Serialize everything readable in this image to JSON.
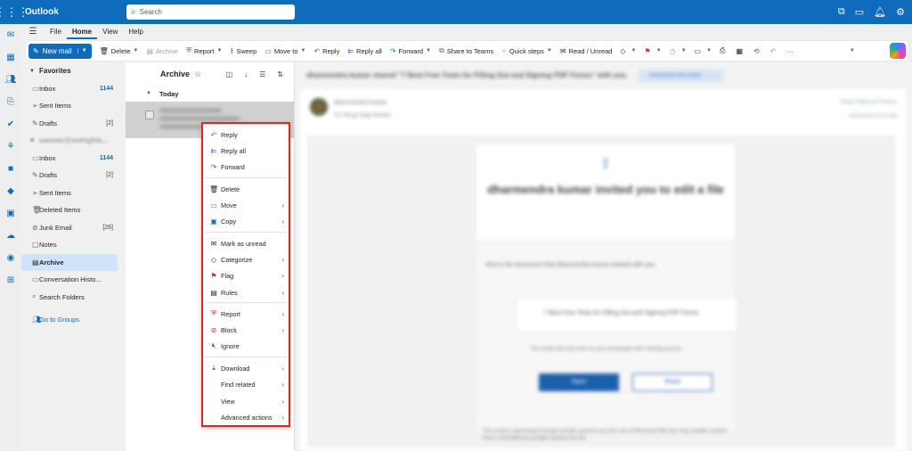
{
  "app": {
    "title": "Outlook",
    "search_placeholder": "Search"
  },
  "header_icons": [
    "teams-icon",
    "feedback-icon",
    "bell-icon",
    "gear-icon"
  ],
  "tabs": [
    {
      "label": "File"
    },
    {
      "label": "Home",
      "active": true
    },
    {
      "label": "View"
    },
    {
      "label": "Help"
    }
  ],
  "ribbon": {
    "new_mail": "New mail",
    "delete": "Delete",
    "archive": "Archive",
    "report": "Report",
    "sweep": "Sweep",
    "move_to": "Move to",
    "reply": "Reply",
    "reply_all": "Reply all",
    "forward": "Forward",
    "share_to_teams": "Share to Teams",
    "quick_steps": "Quick steps",
    "read_unread": "Read / Unread",
    "more": "···"
  },
  "folders": {
    "favorites_label": "Favorites",
    "favorites": [
      {
        "label": "Inbox",
        "count": "1144"
      },
      {
        "label": "Sent Items",
        "count": ""
      },
      {
        "label": "Drafts",
        "count": "[2]"
      }
    ],
    "account_label": "sameer@outrights...",
    "items": [
      {
        "label": "Inbox",
        "count": "1144"
      },
      {
        "label": "Drafts",
        "count": "[2]"
      },
      {
        "label": "Sent Items",
        "count": ""
      },
      {
        "label": "Deleted Items",
        "count": ""
      },
      {
        "label": "Junk Email",
        "count": "[26]"
      },
      {
        "label": "Notes",
        "count": ""
      },
      {
        "label": "Archive",
        "count": "",
        "selected": true
      },
      {
        "label": "Conversation Histo...",
        "count": ""
      },
      {
        "label": "Search Folders",
        "count": ""
      }
    ],
    "go_to_groups": "Go to Groups"
  },
  "list": {
    "title": "Archive",
    "group": "Today"
  },
  "reading": {
    "subject": "dharmendra kumar shared \"7 Best Free Tools for Filling Out and Signing PDF Forms\" with you",
    "summarize": "Summarize this email",
    "from": "dharmendra kumar",
    "to": "To:  Parag Tyagi  Sameer",
    "actions": "Reply   Reply all   Forward",
    "date": "6/18/2025 11:02 AM",
    "invite_title": "dharmendra kumar invited you to edit a file",
    "body_line": "Here's the document that dharmendra kumar shared with you.",
    "doc_name": "7 Best Free Tools for Filling Out and Signing PDF Forms",
    "note": "This invite will only work for you and people with existing access.",
    "open": "Open",
    "share": "Share",
    "footer": "This email is generated through outright systems pvt ltd's use of Microsoft 365 and may contain content that is controlled by outright systems pvt ltd."
  },
  "context_menu": [
    {
      "label": "Reply",
      "icon": "reply-icon",
      "submenu": false
    },
    {
      "label": "Reply all",
      "icon": "reply-all-icon",
      "submenu": false
    },
    {
      "label": "Forward",
      "icon": "forward-icon",
      "submenu": false
    },
    {
      "label": "Delete",
      "icon": "trash-icon",
      "submenu": false
    },
    {
      "label": "Move",
      "icon": "move-folder-icon",
      "submenu": true
    },
    {
      "label": "Copy",
      "icon": "copy-icon",
      "submenu": true
    },
    {
      "label": "Mark as unread",
      "icon": "envelope-icon",
      "submenu": false
    },
    {
      "label": "Categorize",
      "icon": "tag-icon",
      "submenu": true
    },
    {
      "label": "Flag",
      "icon": "flag-icon",
      "submenu": true
    },
    {
      "label": "Rules",
      "icon": "rules-icon",
      "submenu": true
    },
    {
      "label": "Report",
      "icon": "shield-icon",
      "submenu": true
    },
    {
      "label": "Block",
      "icon": "block-icon",
      "submenu": true
    },
    {
      "label": "Ignore",
      "icon": "ignore-icon",
      "submenu": false
    },
    {
      "label": "Download",
      "icon": "download-icon",
      "submenu": true
    },
    {
      "label": "Find related",
      "icon": "",
      "submenu": true
    },
    {
      "label": "View",
      "icon": "",
      "submenu": true
    },
    {
      "label": "Advanced actions",
      "icon": "",
      "submenu": true
    }
  ],
  "colors": {
    "brand": "#0f6cbd",
    "highlight_border": "#e0271c",
    "selected_folder": "#cfe4fa"
  }
}
